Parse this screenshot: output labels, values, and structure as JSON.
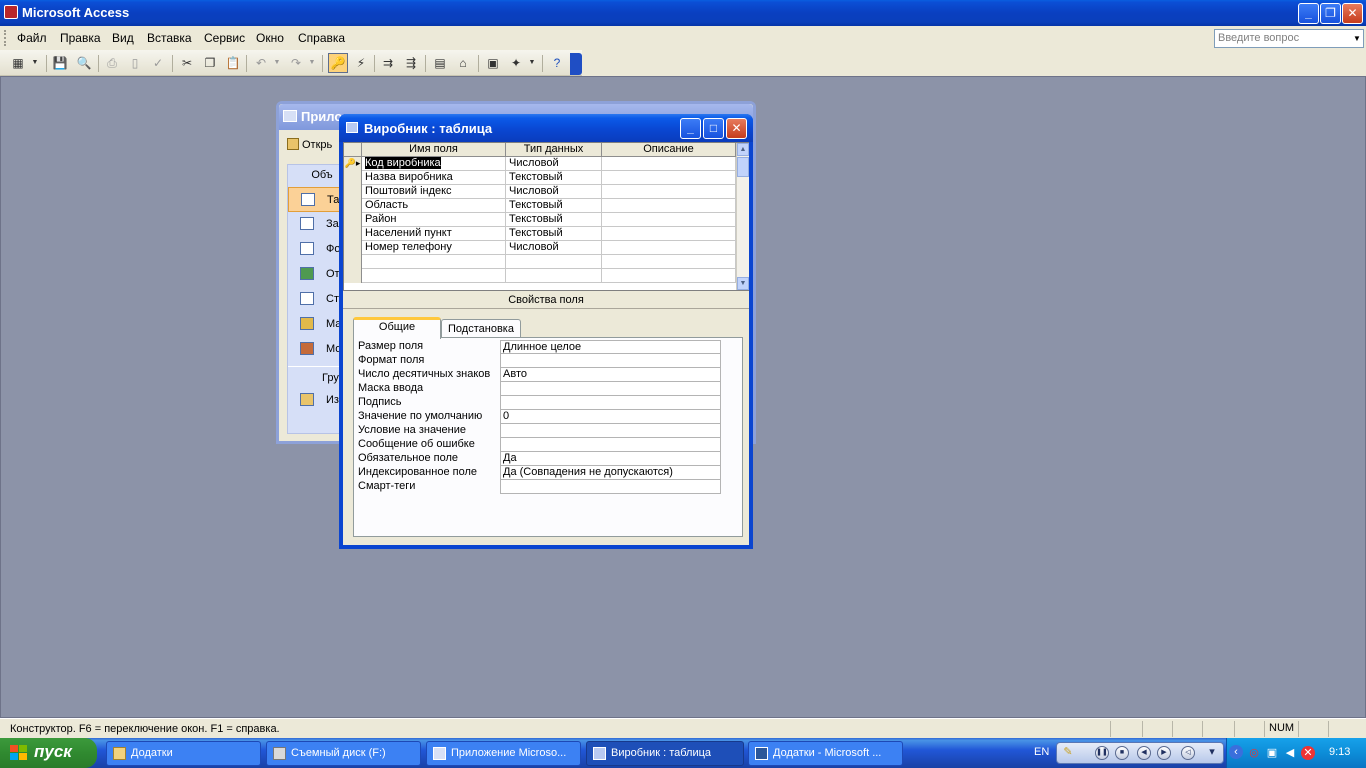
{
  "app": {
    "title": "Microsoft Access"
  },
  "menu": {
    "items": [
      "Файл",
      "Правка",
      "Вид",
      "Вставка",
      "Сервис",
      "Окно",
      "Справка"
    ],
    "ask_placeholder": "Введите вопрос"
  },
  "db_window": {
    "title": "Прило",
    "open_label": "Открь",
    "objects_header": "Объ",
    "objects": [
      "Та",
      "За",
      "Фо",
      "От",
      "Ст",
      "Ма",
      "Мо"
    ],
    "groups_header": "Груп",
    "groups": [
      "Изб"
    ]
  },
  "table_window": {
    "title": "Виробник : таблица",
    "columns": [
      "Имя поля",
      "Тип данных",
      "Описание"
    ],
    "rows": [
      {
        "name": "Код виробника",
        "type": "Числовой",
        "desc": ""
      },
      {
        "name": "Назва виробника",
        "type": "Текстовый",
        "desc": ""
      },
      {
        "name": "Поштовий індекс",
        "type": "Числовой",
        "desc": ""
      },
      {
        "name": "Область",
        "type": "Текстовый",
        "desc": ""
      },
      {
        "name": "Район",
        "type": "Текстовый",
        "desc": ""
      },
      {
        "name": "Населений пункт",
        "type": "Текстовый",
        "desc": ""
      },
      {
        "name": "Номер телефону",
        "type": "Числовой",
        "desc": ""
      }
    ],
    "props_label": "Свойства поля",
    "tabs": [
      "Общие",
      "Подстановка"
    ],
    "properties": [
      {
        "label": "Размер поля",
        "value": "Длинное целое"
      },
      {
        "label": "Формат поля",
        "value": ""
      },
      {
        "label": "Число десятичных знаков",
        "value": "Авто"
      },
      {
        "label": "Маска ввода",
        "value": ""
      },
      {
        "label": "Подпись",
        "value": ""
      },
      {
        "label": "Значение по умолчанию",
        "value": "0"
      },
      {
        "label": "Условие на значение",
        "value": ""
      },
      {
        "label": "Сообщение об ошибке",
        "value": ""
      },
      {
        "label": "Обязательное поле",
        "value": "Да"
      },
      {
        "label": "Индексированное поле",
        "value": "Да (Совпадения не допускаются)"
      },
      {
        "label": "Смарт-теги",
        "value": ""
      }
    ]
  },
  "status": {
    "message": "Конструктор.  F6 = переключение окон.  F1 = справка.",
    "num": "NUM"
  },
  "taskbar": {
    "start": "пуск",
    "tasks": [
      "Додатки",
      "Съемный диск (F:)",
      "Приложение Microso...",
      "Виробник : таблица",
      "Додатки - Microsoft ..."
    ],
    "lang": "EN",
    "clock": "9:13"
  },
  "colors": {
    "titlebar": "#0a47d2",
    "workspace": "#8c93a8",
    "highlight": "#fdd27a"
  }
}
